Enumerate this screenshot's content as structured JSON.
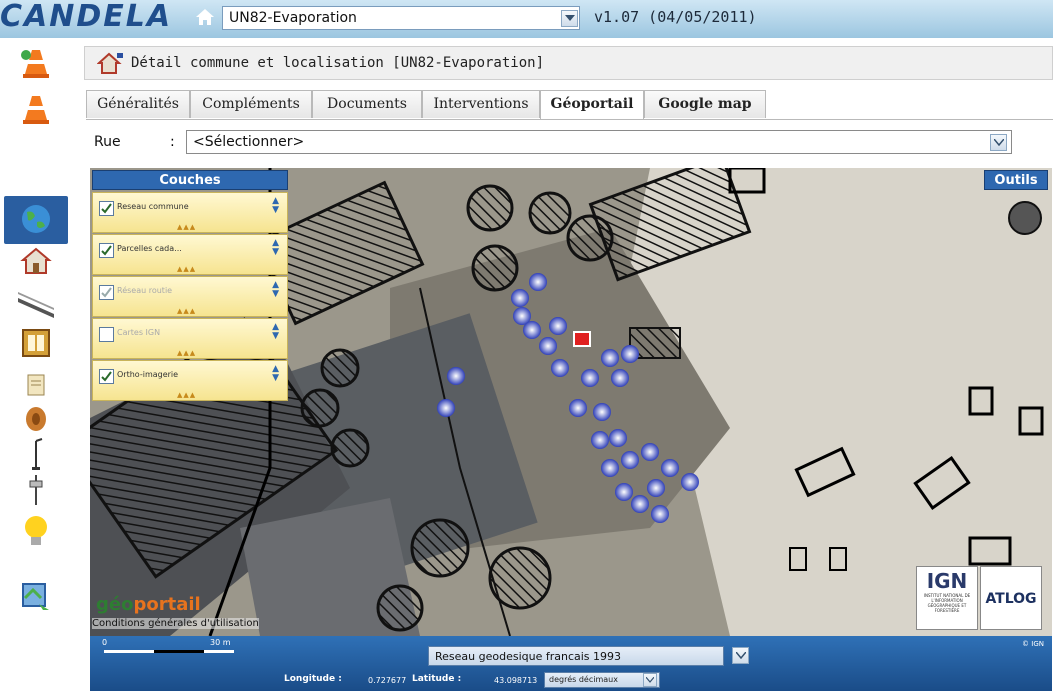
{
  "app": {
    "logo_text": "CANDELA",
    "site": "UN82-Evaporation",
    "version": "v1.07 (04/05/2011)"
  },
  "panel": {
    "title": "Détail commune et localisation [UN82-Evaporation]"
  },
  "tabs": [
    {
      "label": "Généralités",
      "active": false
    },
    {
      "label": "Compléments",
      "active": false
    },
    {
      "label": "Documents",
      "active": false
    },
    {
      "label": "Interventions",
      "active": false
    },
    {
      "label": "Géoportail",
      "active": true
    },
    {
      "label": "Google map",
      "active": false
    }
  ],
  "rue": {
    "label": "Rue",
    "colon": ":",
    "value": "<Sélectionner>"
  },
  "map": {
    "couches_title": "Couches",
    "outils_label": "Outils",
    "layers": [
      {
        "label": "Reseau commune",
        "checked": true,
        "disabled": false
      },
      {
        "label": "Parcelles cada...",
        "checked": true,
        "disabled": false
      },
      {
        "label": "Réseau routie",
        "checked": true,
        "disabled": true
      },
      {
        "label": "Cartes IGN",
        "checked": false,
        "disabled": true
      },
      {
        "label": "Ortho-imagerie",
        "checked": true,
        "disabled": false
      }
    ],
    "geo_logo_a": "géo",
    "geo_logo_b": "portail",
    "cgu": "Conditions générales d'utilisation",
    "ign_big": "IGN",
    "ign_small": "INSTITUT NATIONAL DE L'INFORMATION GÉOGRAPHIQUE ET FORESTIÈRE",
    "atlog": "ATLOG"
  },
  "bottom": {
    "scale_zero": "0",
    "scale_label": "30 m",
    "projection": "Reseau geodesique francais 1993",
    "copyright": "© IGN",
    "longitude_label": "Longitude :",
    "longitude_value": "0.727677",
    "latitude_label": "Latitude :",
    "latitude_value": "43.098713",
    "unit": "degrés décimaux"
  },
  "colors": {
    "accent": "#2e68b0",
    "map_bg": "#a6a294",
    "layer_bg": "#f6e490"
  }
}
